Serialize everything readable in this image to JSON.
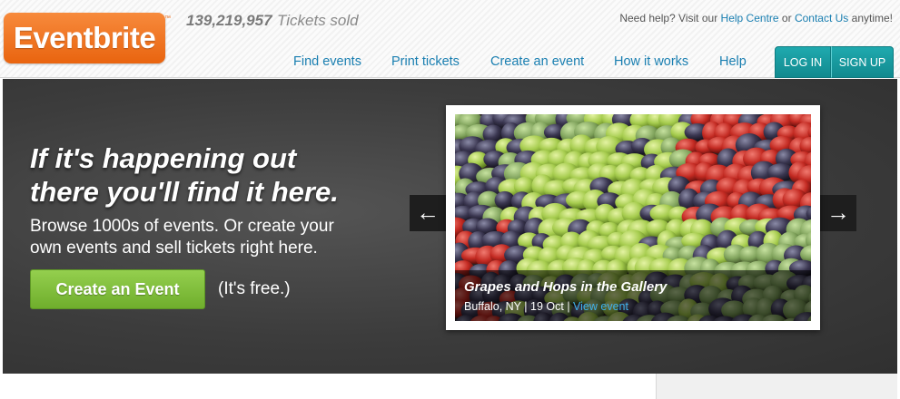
{
  "header": {
    "logo_text": "Eventbrite",
    "logo_tm": "™",
    "tickets_count": "139,219,957",
    "tickets_label": "Tickets sold",
    "help_prefix": "Need help? Visit our",
    "help_centre": "Help Centre",
    "help_or": "or",
    "contact_us": "Contact Us",
    "help_suffix": "anytime!",
    "nav": [
      "Find events",
      "Print tickets",
      "Create an event",
      "How it works",
      "Help"
    ],
    "login": "LOG IN",
    "signup": "SIGN UP"
  },
  "hero": {
    "headline_line1": "If it's happening out",
    "headline_line2": "there you'll find it here.",
    "subtext_line1": "Browse 1000s of events. Or create your",
    "subtext_line2": "own events and sell tickets right here.",
    "cta_label": "Create an Event",
    "free_note": "(It's free.)"
  },
  "carousel": {
    "prev_icon": "←",
    "next_icon": "→",
    "slide": {
      "title": "Grapes and Hops in the Gallery",
      "location": "Buffalo, NY",
      "date": "19 Oct",
      "separator": "|",
      "link": "View event"
    }
  },
  "colors": {
    "brand_orange": "#e9640f",
    "link_blue": "#1a7fb1",
    "teal": "#1a9ea3",
    "green": "#7dbd3a"
  }
}
